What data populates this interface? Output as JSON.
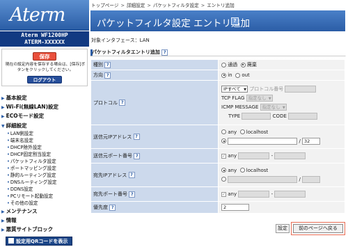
{
  "brand": {
    "logo": "Aterm",
    "model_line1": "Aterm WF1200HP",
    "model_line2": "ATERM-XXXXXX"
  },
  "save": {
    "button": "保存",
    "note": "現在の設定内容を保存する場合は、[保存]ボタンをクリックしてください。",
    "logout": "ログアウト"
  },
  "menu": {
    "basic": "基本設定",
    "wifi": "Wi-Fi(無線LAN)設定",
    "eco": "ECOモード設定",
    "detail": "詳細設定",
    "detail_items": [
      "LAN側設定",
      "端末名設定",
      "DHCP除外設定",
      "DHCP固定割当設定",
      "パケットフィルタ設定",
      "ポートマッピング設定",
      "静的ルーティング設定",
      "DNSルーティング設定",
      "DDNS設定",
      "PCリモート起動設定",
      "その他の設定"
    ],
    "maintenance": "メンテナンス",
    "info": "情報",
    "block": "悪質サイトブロック",
    "qr": "設定用QRコードを表示"
  },
  "breadcrumb": [
    "トップページ",
    "詳細設定",
    "パケットフィルタ設定",
    "エントリ追加"
  ],
  "page_title": "パケットフィルタ設定 エントリ追加",
  "interface_label": "対象インタフェース：LAN",
  "section_title": "パケットフィルタエントリ追加",
  "form": {
    "type": {
      "label": "種別",
      "opt1": "通過",
      "opt2": "廃棄"
    },
    "direction": {
      "label": "方向",
      "opt1": "in",
      "opt2": "out"
    },
    "protocol": {
      "label": "プロトコル",
      "select": "IPすべて",
      "proto_num": "プロトコル番号",
      "tcp_flag": "TCP FLAG",
      "tcp_flag_value": "指定なし",
      "icmp": "ICMP MESSAGE",
      "icmp_value": "指定なし",
      "type": "TYPE",
      "code": "CODE"
    },
    "src_ip": {
      "label": "送信元IPアドレス",
      "any": "any",
      "localhost": "localhost",
      "mask": "32"
    },
    "src_port": {
      "label": "送信元ポート番号",
      "any": "any"
    },
    "dst_ip": {
      "label": "宛先IPアドレス",
      "any": "any",
      "localhost": "localhost"
    },
    "dst_port": {
      "label": "宛先ポート番号",
      "any": "any"
    },
    "priority": {
      "label": "優先度",
      "value": "2"
    }
  },
  "buttons": {
    "set": "設定",
    "back": "前のページへ戻る"
  },
  "help": "?"
}
